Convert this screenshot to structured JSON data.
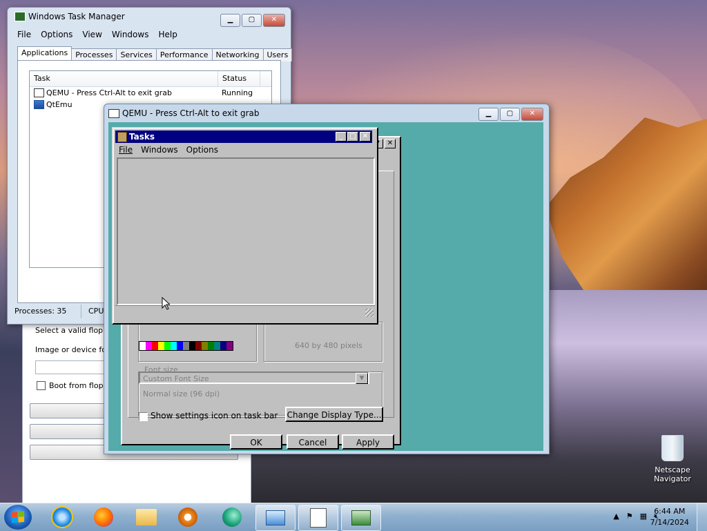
{
  "desktop": {
    "icons": [
      {
        "label": "Netscape Navigator",
        "icon": "recycle-bin-icon"
      }
    ]
  },
  "task_manager": {
    "title": "Windows Task Manager",
    "menu": [
      "File",
      "Options",
      "View",
      "Windows",
      "Help"
    ],
    "tabs": [
      "Applications",
      "Processes",
      "Services",
      "Performance",
      "Networking",
      "Users"
    ],
    "active_tab": "Applications",
    "columns": [
      "Task",
      "Status"
    ],
    "rows": [
      {
        "task": "QEMU - Press Ctrl-Alt to exit grab",
        "status": "Running"
      },
      {
        "task": "QtEmu",
        "status": ""
      }
    ],
    "status_bar": {
      "processes": "Processes: 35",
      "cpu": "CPU"
    }
  },
  "qtemu_dialog": {
    "labels": [
      "Select a valid floppy",
      "Image or device for",
      "Boot from floppy"
    ]
  },
  "qemu": {
    "title": "QEMU - Press Ctrl-Alt to exit grab",
    "guest": {
      "display_properties": {
        "resolution_text": "640 by 480 pixels",
        "font_size_legend": "Font size",
        "font_size_value": "Custom Font Size",
        "font_size_note": "Normal size (96 dpi)",
        "show_settings_label": "Show settings icon on task bar",
        "change_display_button": "Change Display Type...",
        "ok": "OK",
        "cancel": "Cancel",
        "apply": "Apply",
        "palette": [
          "#ffffff",
          "#ff00ff",
          "#ff0000",
          "#ffff00",
          "#00ff00",
          "#00ffff",
          "#0000ff",
          "#808080",
          "#000000",
          "#800000",
          "#808000",
          "#008000",
          "#008080",
          "#000080",
          "#800080"
        ]
      },
      "tasks": {
        "title": "Tasks",
        "menu": [
          "File",
          "Windows",
          "Options"
        ]
      }
    }
  },
  "taskbar": {
    "pinned": [
      "internet-explorer-icon",
      "firefox-icon",
      "folder-icon",
      "media-player-icon",
      "qtemu-icon"
    ],
    "open": [
      "display-window-icon",
      "document-icon",
      "task-manager-icon"
    ],
    "clock": {
      "time": "6:44 AM",
      "date": "7/14/2024"
    }
  }
}
